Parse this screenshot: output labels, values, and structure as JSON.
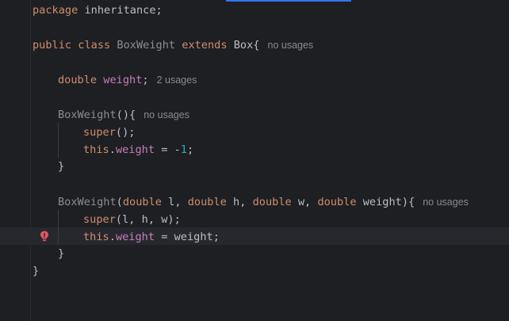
{
  "editor": {
    "line1": {
      "kw": "package",
      "text": " inheritance;"
    },
    "line2": {
      "kw1": "public",
      "kw2": "class",
      "class_name": "BoxWeight",
      "kw3": "extends",
      "superclass": "Box{",
      "hint": "no usages"
    },
    "line3": {
      "type": "double",
      "field": "weight",
      "semi": ";",
      "hint": "2 usages"
    },
    "line4": {
      "ctor": "BoxWeight",
      "paren": "(){",
      "hint": "no usages"
    },
    "line5": {
      "kw": "super",
      "rest": "();"
    },
    "line6": {
      "kw": "this",
      "dot": ".",
      "field": "weight",
      "op": " = -",
      "num": "1",
      "semi": ";"
    },
    "line7": {
      "brace": "}"
    },
    "line8": {
      "ctor": "BoxWeight",
      "p0": "(",
      "t1": "double",
      "a1": " l, ",
      "t2": "double",
      "a2": " h, ",
      "t3": "double",
      "a3": " w, ",
      "t4": "double",
      "a4": " weight){",
      "hint": "no usages"
    },
    "line9": {
      "kw": "super",
      "rest": "(l, h, w);"
    },
    "line10": {
      "kw": "this",
      "dot": ".",
      "field": "weight",
      "rest": " = weight;"
    },
    "line11": {
      "brace": "}"
    },
    "line12": {
      "brace": "}"
    }
  },
  "gutter": {
    "icon": "intention-bulb-icon",
    "icon_color": "#e55765"
  },
  "colors": {
    "background": "#1e1f22",
    "keyword": "#cf8e6d",
    "field": "#c77dbb",
    "number": "#2aacb8",
    "text": "#bcbec4",
    "hint": "#868a91"
  }
}
